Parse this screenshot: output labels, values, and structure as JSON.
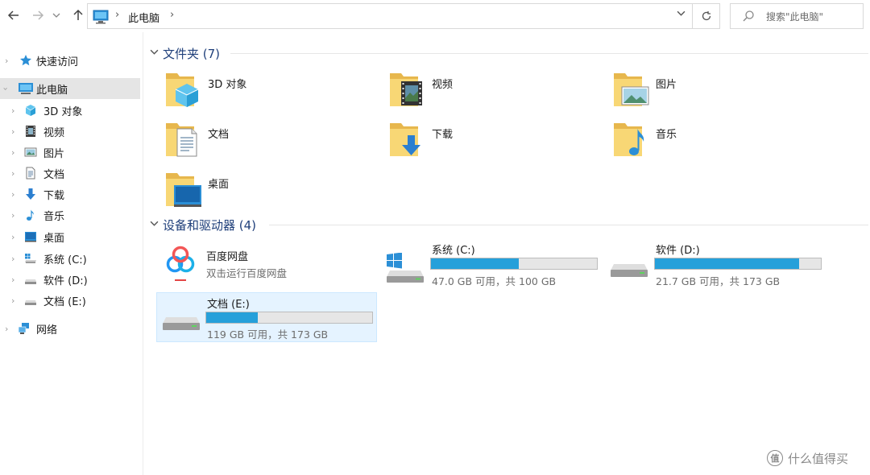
{
  "address_bar": {
    "path": "此电脑"
  },
  "search": {
    "placeholder": "搜索\"此电脑\""
  },
  "sidebar": {
    "items": [
      {
        "label": "快速访问"
      },
      {
        "label": "此电脑"
      },
      {
        "label": "3D 对象"
      },
      {
        "label": "视频"
      },
      {
        "label": "图片"
      },
      {
        "label": "文档"
      },
      {
        "label": "下载"
      },
      {
        "label": "音乐"
      },
      {
        "label": "桌面"
      },
      {
        "label": "系统 (C:)"
      },
      {
        "label": "软件 (D:)"
      },
      {
        "label": "文档 (E:)"
      },
      {
        "label": "网络"
      }
    ]
  },
  "main": {
    "folders_header": "文件夹 (7)",
    "folders": [
      {
        "label": "3D 对象",
        "icon": "3d-objects-icon"
      },
      {
        "label": "视频",
        "icon": "video-icon"
      },
      {
        "label": "图片",
        "icon": "pictures-icon"
      },
      {
        "label": "文档",
        "icon": "documents-icon"
      },
      {
        "label": "下载",
        "icon": "downloads-icon"
      },
      {
        "label": "音乐",
        "icon": "music-icon"
      },
      {
        "label": "桌面",
        "icon": "desktop-icon"
      }
    ],
    "devices_header": "设备和驱动器 (4)",
    "baidu": {
      "name": "百度网盘",
      "sub": "双击运行百度网盘"
    },
    "drives": [
      {
        "name": "系统 (C:)",
        "info": "47.0 GB 可用，共 100 GB",
        "used_fraction": 0.53
      },
      {
        "name": "软件 (D:)",
        "info": "21.7 GB 可用，共 173 GB",
        "used_fraction": 0.87
      },
      {
        "name": "文档 (E:)",
        "info": "119 GB 可用，共 173 GB",
        "used_fraction": 0.31
      }
    ]
  },
  "watermark": {
    "logo": "值",
    "text": "什么值得买"
  },
  "colors": {
    "accent": "#26a0da",
    "section_title": "#1f3f7a",
    "folder_yellow": "#f8d775"
  }
}
